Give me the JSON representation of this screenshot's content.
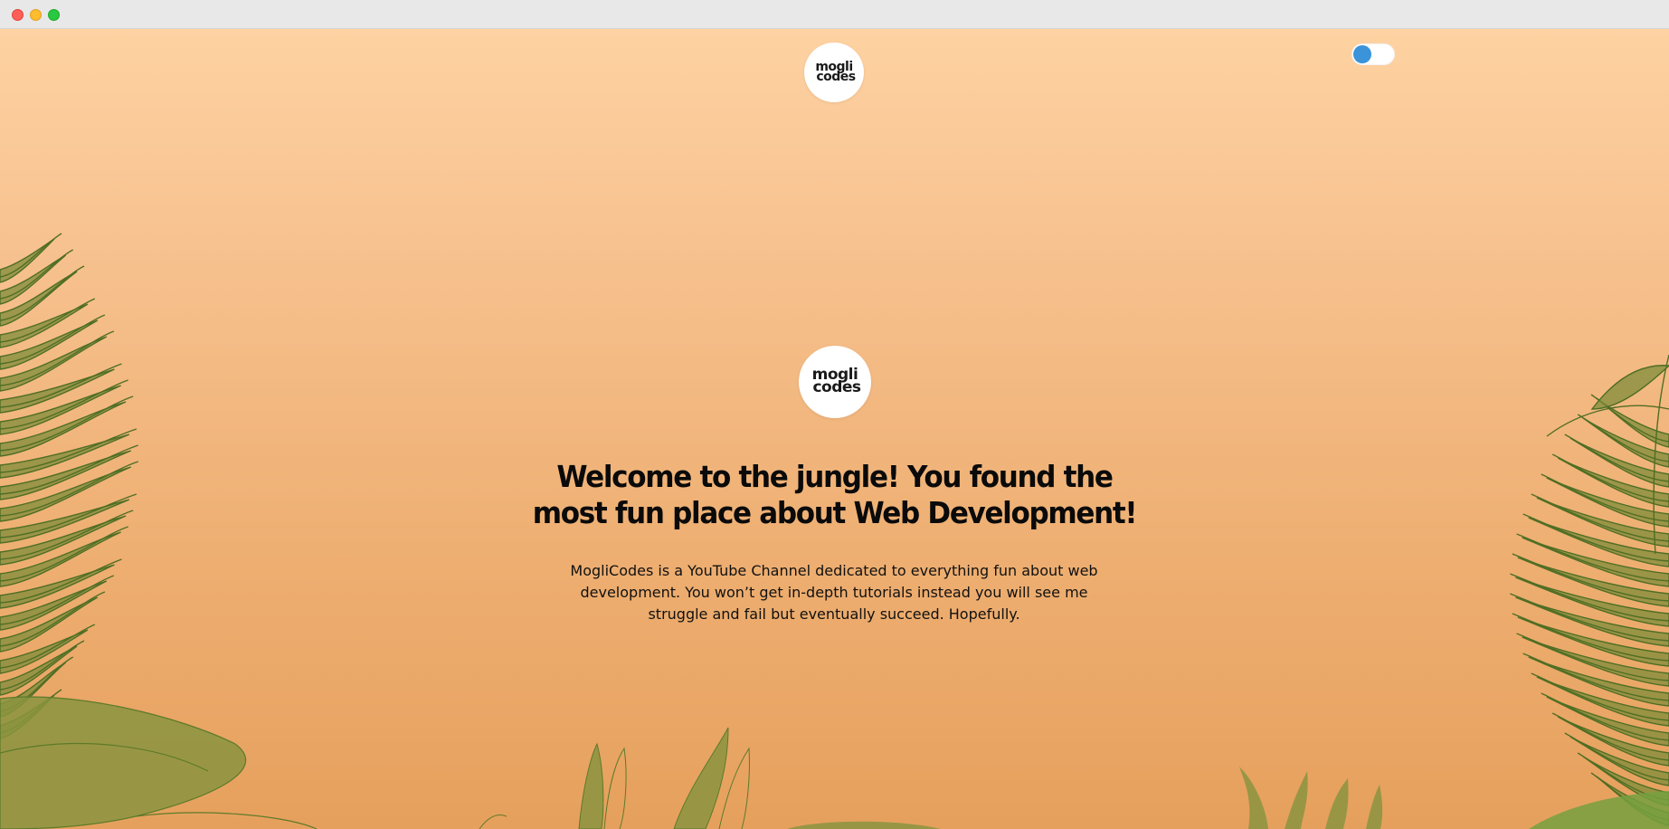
{
  "window": {
    "controls": [
      "close",
      "minimize",
      "maximize"
    ]
  },
  "colors": {
    "gradient_top": "#fed2a2",
    "gradient_bottom": "#e6a05d",
    "toggle_knob": "#3b93d9",
    "leaf_dark": "#4f6e24",
    "leaf_fill": "#7f8c3a"
  },
  "nav": {
    "logo": {
      "line1": "mogli",
      "line2": "codes",
      "icon": "moglicodes-logo"
    },
    "theme_toggle": {
      "state": "off",
      "icon": "toggle-switch"
    }
  },
  "hero": {
    "logo": {
      "line1": "mogli",
      "line2": "codes",
      "icon": "moglicodes-logo"
    },
    "title": "Welcome to the jungle! You found the most fun place about Web Development!",
    "description": "MogliCodes is a YouTube Channel dedicated to everything fun about web development. You won’t get in-depth tutorials instead you will see me struggle and fail but eventually succeed. Hopefully."
  }
}
